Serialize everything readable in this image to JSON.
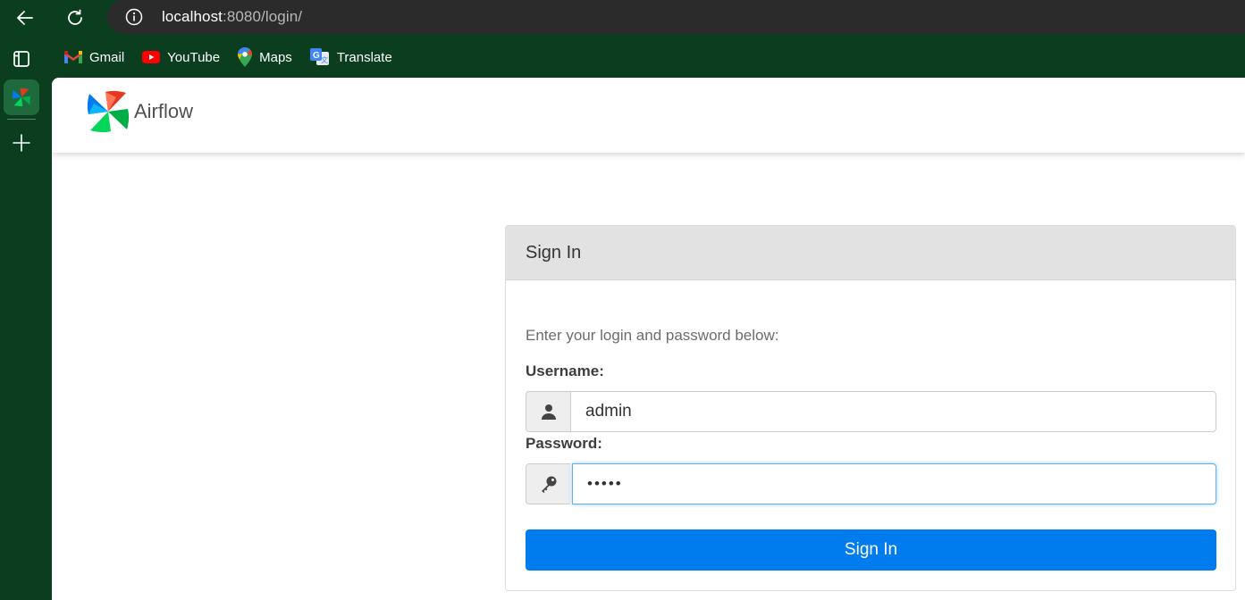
{
  "browser": {
    "url_host": "localhost",
    "url_rest": ":8080/login/",
    "bookmarks": [
      {
        "label": "Gmail",
        "icon": "gmail-icon"
      },
      {
        "label": "YouTube",
        "icon": "youtube-icon"
      },
      {
        "label": "Maps",
        "icon": "maps-icon"
      },
      {
        "label": "Translate",
        "icon": "translate-icon"
      }
    ]
  },
  "app": {
    "brand": "Airflow"
  },
  "login": {
    "title": "Sign In",
    "instructions": "Enter your login and password below:",
    "username_label": "Username:",
    "username_value": "admin",
    "password_label": "Password:",
    "password_value": "•••••",
    "submit_label": "Sign In"
  },
  "colors": {
    "chrome_bg": "#0b3d1f",
    "primary_button": "#017cee",
    "panel_header": "#e2e2e2"
  }
}
